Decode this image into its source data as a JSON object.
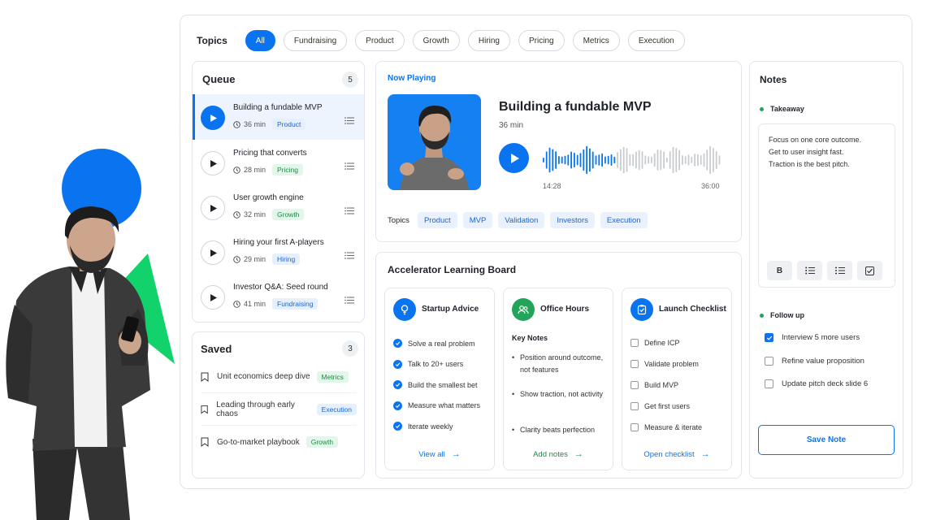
{
  "topics_bar": {
    "label": "Topics",
    "chips": [
      "All",
      "Fundraising",
      "Product",
      "Growth",
      "Hiring",
      "Pricing",
      "Metrics",
      "Execution"
    ]
  },
  "queue": {
    "title": "Queue",
    "count": "5",
    "items": [
      {
        "title": "Building a fundable MVP",
        "duration": "36 min",
        "tag": "Product",
        "tag_color": "blue"
      },
      {
        "title": "Pricing that converts",
        "duration": "28 min",
        "tag": "Pricing",
        "tag_color": "green"
      },
      {
        "title": "User growth engine",
        "duration": "32 min",
        "tag": "Growth",
        "tag_color": "green"
      },
      {
        "title": "Hiring your first A-players",
        "duration": "29 min",
        "tag": "Hiring",
        "tag_color": "blue"
      },
      {
        "title": "Investor Q&A: Seed round",
        "duration": "41 min",
        "tag": "Fundraising",
        "tag_color": "blue"
      }
    ]
  },
  "saved": {
    "title": "Saved",
    "count": "3",
    "items": [
      {
        "title": "Unit economics deep dive",
        "tag": "Metrics",
        "tag_color": "green"
      },
      {
        "title": "Leading through early chaos",
        "tag": "Execution",
        "tag_color": "blue"
      },
      {
        "title": "Go-to-market playbook",
        "tag": "Growth",
        "tag_color": "green"
      }
    ]
  },
  "now_playing": {
    "label": "Now Playing",
    "title": "Building a fundable MVP",
    "duration": "36 min",
    "time_start": "14:28",
    "time_end": "36:00",
    "progress": 0.4,
    "topics_label": "Topics",
    "topics": [
      "Product",
      "MVP",
      "Validation",
      "Investors",
      "Execution"
    ]
  },
  "board": {
    "title": "Accelerator Learning Board",
    "startup": {
      "title": "Startup Advice",
      "items": [
        "Solve a real problem",
        "Talk to 20+ users",
        "Build the smallest bet",
        "Measure what matters",
        "Iterate weekly"
      ],
      "link": "View all"
    },
    "office": {
      "title": "Office Hours",
      "subtitle": "Key Notes",
      "bullets": [
        "Position around outcome, not features",
        "Show traction, not activity",
        "Clarity beats perfection"
      ],
      "link": "Add notes"
    },
    "launch": {
      "title": "Launch Checklist",
      "items": [
        "Define ICP",
        "Validate problem",
        "Build MVP",
        "Get first users",
        "Measure & iterate"
      ],
      "link": "Open checklist"
    }
  },
  "notes": {
    "title": "Notes",
    "takeaway_label": "Takeaway",
    "lines": [
      "Focus on one core outcome.",
      "Get to user insight fast.",
      "Traction is the best pitch."
    ],
    "tools": [
      "B",
      "bulleted-list-icon",
      "numbered-list-icon",
      "checkbox-icon"
    ],
    "bold_label": "B",
    "follow_label": "Follow up",
    "follow": [
      {
        "label": "Interview 5 more users",
        "checked": true
      },
      {
        "label": "Refine value proposition",
        "checked": false
      },
      {
        "label": "Update pitch deck slide 6",
        "checked": false
      }
    ],
    "save": "Save Note"
  },
  "colors": {
    "accent": "#0a74f0",
    "green": "#22a55a",
    "deco_green": "#12d36b"
  }
}
